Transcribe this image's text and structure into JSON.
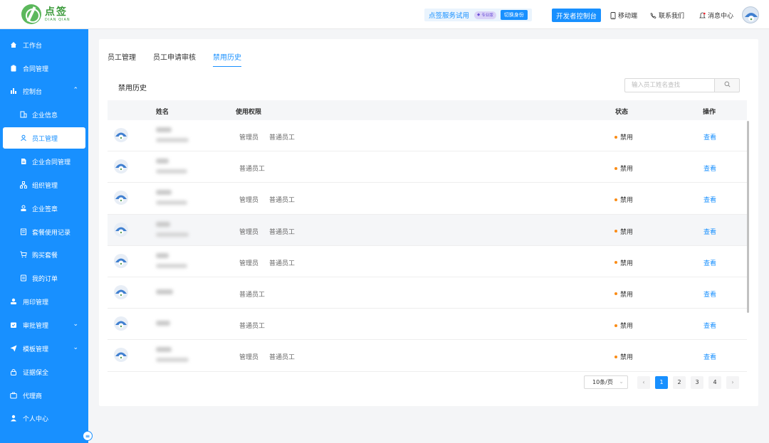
{
  "header": {
    "logo_cn": "点签",
    "logo_en": "DIAN QIAN",
    "trial_text": "点签服务试用",
    "edition_badge": "专业版",
    "switch_identity": "切换身份",
    "developer_console": "开发者控制台",
    "mobile": "移动端",
    "contact": "联系我们",
    "messages": "消息中心"
  },
  "sidebar": {
    "items": [
      {
        "label": "工作台",
        "icon": "home-icon"
      },
      {
        "label": "合同管理",
        "icon": "clipboard-icon"
      },
      {
        "label": "控制台",
        "icon": "bar-chart-icon",
        "expanded": true
      },
      {
        "label": "企业信息",
        "icon": "building-icon"
      },
      {
        "label": "员工管理",
        "icon": "user-icon",
        "active": true
      },
      {
        "label": "企业合同管理",
        "icon": "document-icon"
      },
      {
        "label": "组织管理",
        "icon": "org-tree-icon"
      },
      {
        "label": "企业签章",
        "icon": "stamp-icon"
      },
      {
        "label": "套餐使用记录",
        "icon": "record-icon"
      },
      {
        "label": "购买套餐",
        "icon": "cart-icon"
      },
      {
        "label": "我的订单",
        "icon": "order-icon"
      },
      {
        "label": "用印管理",
        "icon": "seal-icon"
      },
      {
        "label": "审批管理",
        "icon": "approval-icon",
        "collapsed": true
      },
      {
        "label": "模板管理",
        "icon": "send-icon",
        "collapsed": true
      },
      {
        "label": "证据保全",
        "icon": "lock-icon"
      },
      {
        "label": "代理商",
        "icon": "briefcase-icon"
      },
      {
        "label": "个人中心",
        "icon": "person-icon"
      }
    ]
  },
  "tabs": [
    "员工管理",
    "员工申请审核",
    "禁用历史"
  ],
  "active_tab": "禁用历史",
  "section_title": "禁用历史",
  "search": {
    "placeholder": "输入员工姓名查找"
  },
  "table": {
    "columns": [
      "姓名",
      "使用权限",
      "状态",
      "操作"
    ],
    "rows": [
      {
        "permissions": [
          "管理员",
          "普通员工"
        ],
        "status": "禁用",
        "action": "查看"
      },
      {
        "permissions": [
          "普通员工"
        ],
        "status": "禁用",
        "action": "查看"
      },
      {
        "permissions": [
          "管理员",
          "普通员工"
        ],
        "status": "禁用",
        "action": "查看"
      },
      {
        "permissions": [
          "管理员",
          "普通员工"
        ],
        "status": "禁用",
        "action": "查看"
      },
      {
        "permissions": [
          "管理员",
          "普通员工"
        ],
        "status": "禁用",
        "action": "查看"
      },
      {
        "permissions": [
          "普通员工"
        ],
        "status": "禁用",
        "action": "查看"
      },
      {
        "permissions": [
          "普通员工"
        ],
        "status": "禁用",
        "action": "查看"
      },
      {
        "permissions": [
          "管理员",
          "普通员工"
        ],
        "status": "禁用",
        "action": "查看"
      }
    ]
  },
  "pagination": {
    "page_size": "10条/页",
    "pages": [
      "1",
      "2",
      "3",
      "4"
    ],
    "current": "1"
  },
  "colors": {
    "accent": "#1890ff",
    "status_dot": "#fa8c16"
  }
}
